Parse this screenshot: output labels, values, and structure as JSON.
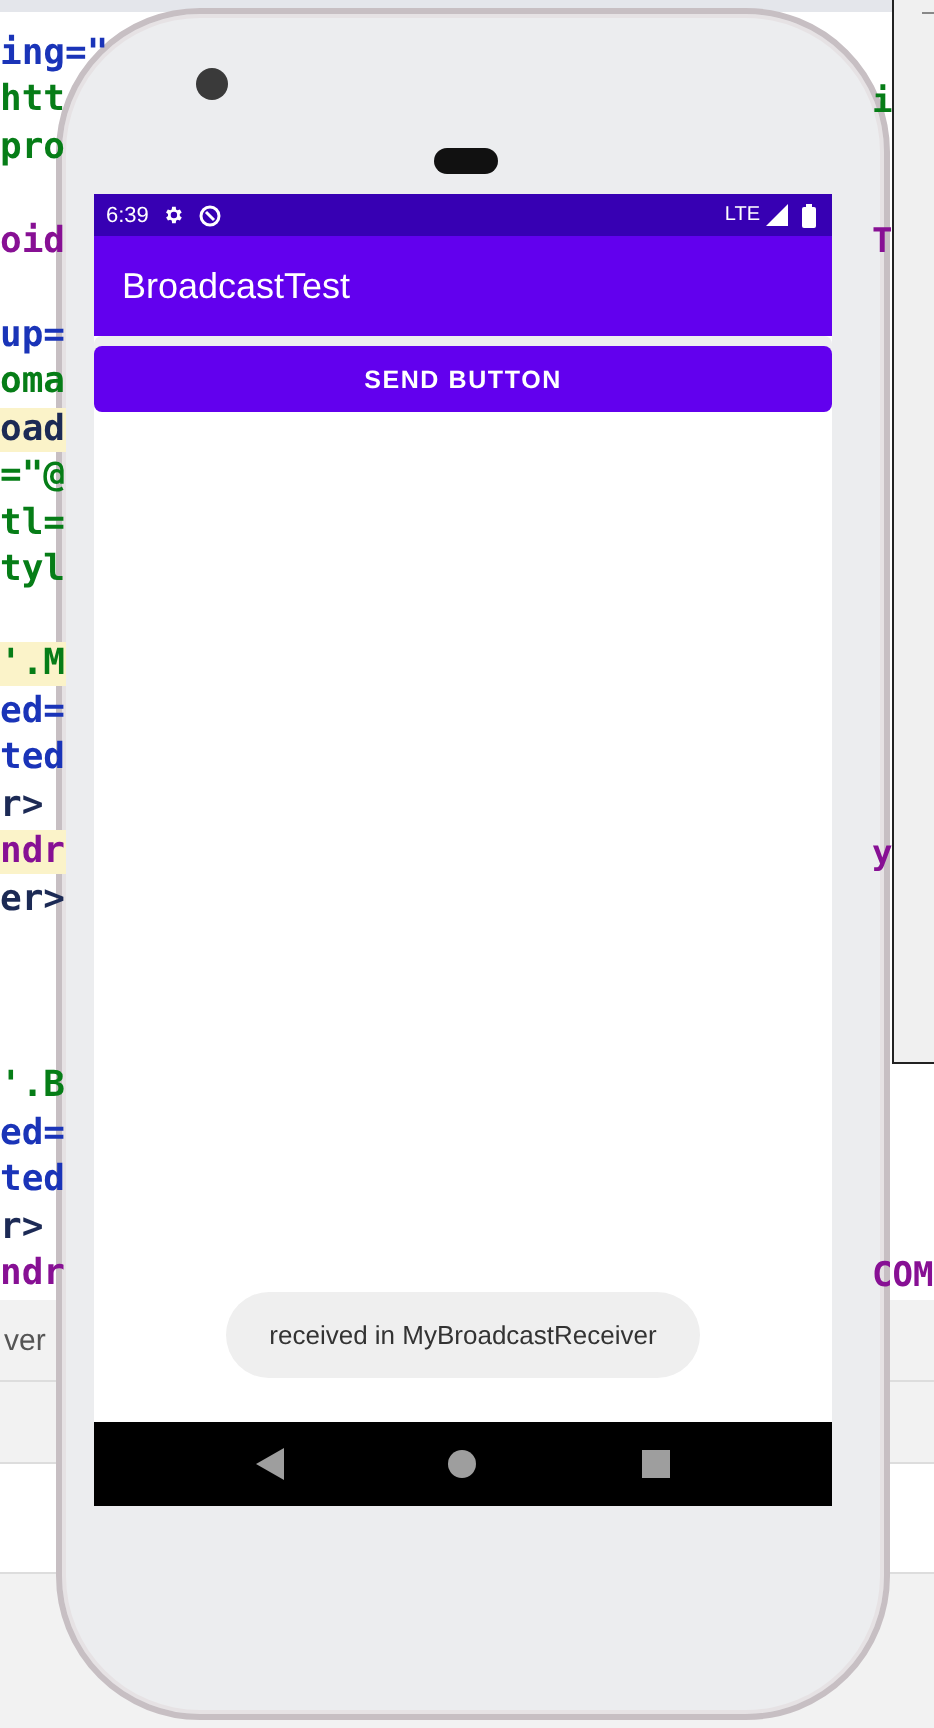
{
  "editor": {
    "blocks": [
      {
        "lines": [
          {
            "text": "ing=\"",
            "kind": "attr",
            "highlighted": false
          },
          {
            "text": "htt",
            "kind": "value",
            "highlighted": false,
            "right": "i"
          },
          {
            "text": "pro",
            "kind": "value",
            "highlighted": false
          }
        ]
      },
      {
        "lines": [
          {
            "text": "oid",
            "kind": "tag",
            "highlighted": false,
            "right": "T"
          }
        ]
      },
      {
        "lines": [
          {
            "text": "up=",
            "kind": "attr",
            "highlighted": false
          },
          {
            "text": "oma",
            "kind": "value",
            "highlighted": false
          },
          {
            "text": "oad",
            "kind": "plain",
            "highlighted": true
          },
          {
            "text": "=\"@",
            "kind": "value",
            "highlighted": false
          },
          {
            "text": "tl=",
            "kind": "value",
            "highlighted": false
          },
          {
            "text": "tyl",
            "kind": "value",
            "highlighted": false
          }
        ]
      },
      {
        "lines": [
          {
            "text": "'.M",
            "kind": "value",
            "highlighted": true
          },
          {
            "text": "ed=",
            "kind": "attr",
            "highlighted": false
          },
          {
            "text": "ted",
            "kind": "attr",
            "highlighted": false
          },
          {
            "text": "r>",
            "kind": "plain",
            "highlighted": false
          },
          {
            "text": "ndr",
            "kind": "tag",
            "highlighted": true,
            "right": "y"
          },
          {
            "text": "er>",
            "kind": "plain",
            "highlighted": false
          }
        ]
      },
      {
        "lines": [
          {
            "text": "'.B",
            "kind": "value",
            "highlighted": false
          },
          {
            "text": "ed=",
            "kind": "attr",
            "highlighted": false
          },
          {
            "text": "ted",
            "kind": "attr",
            "highlighted": false
          },
          {
            "text": "r>",
            "kind": "plain",
            "highlighted": false
          },
          {
            "text": "ndr",
            "kind": "tag",
            "highlighted": false,
            "right": "COM"
          }
        ]
      }
    ]
  },
  "bottom_panel": {
    "text": "ver"
  },
  "phone": {
    "status_bar": {
      "time": "6:39",
      "network": "LTE"
    },
    "app_bar": {
      "title": "BroadcastTest"
    },
    "button": {
      "label": "SEND BUTTON"
    },
    "toast": {
      "text": "received in MyBroadcastReceiver"
    }
  }
}
